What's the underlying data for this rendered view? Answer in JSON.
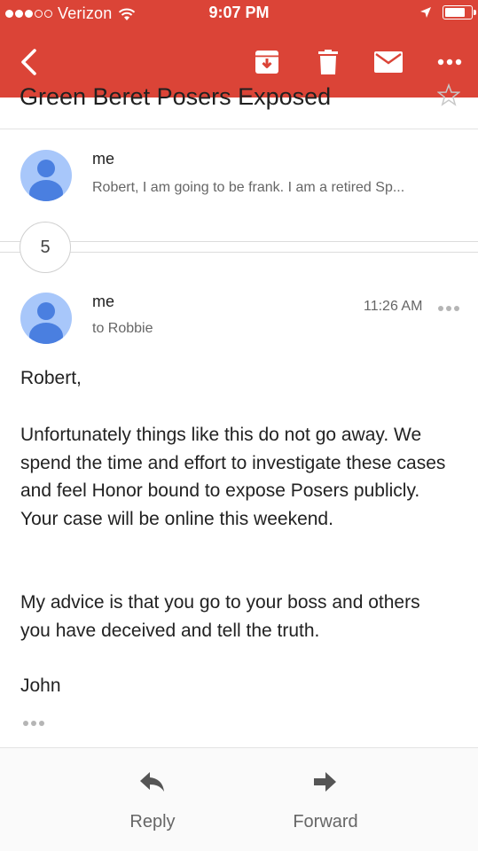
{
  "status_bar": {
    "carrier": "Verizon",
    "time": "9:07 PM",
    "signal_filled": 3,
    "signal_total": 5,
    "battery_level": 0.8
  },
  "toolbar": {
    "icons": [
      "back-arrow-icon",
      "archive-icon",
      "trash-icon",
      "mail-icon",
      "more-dots-icon"
    ]
  },
  "subject": "Green Beret Posers Exposed",
  "collapsed_message": {
    "sender": "me",
    "snippet": "Robert, I am going to be frank. I am a retired Sp..."
  },
  "hidden_count": "5",
  "open_message": {
    "sender": "me",
    "time": "11:26 AM",
    "to": "to Robbie",
    "body": [
      "Robert,",
      "Unfortunately things like this do not go away.  We spend the time and effort to investigate these cases and feel Honor bound to expose Posers publicly. Your case will be online this weekend.",
      "My advice is that you go to your boss and others you have deceived and tell the truth.",
      "John"
    ]
  },
  "footer": {
    "reply_label": "Reply",
    "forward_label": "Forward"
  },
  "colors": {
    "header": "#db4437",
    "avatar_bg": "#a8c7fa",
    "avatar_fg": "#4a7fe0"
  }
}
